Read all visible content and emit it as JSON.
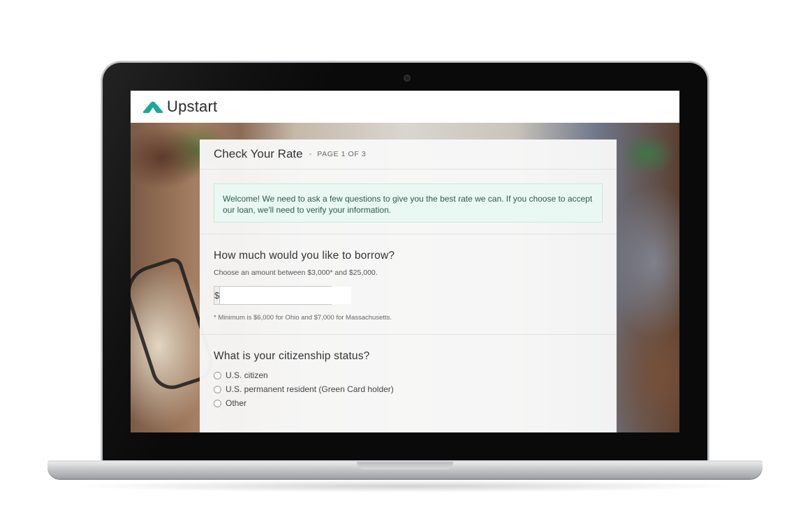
{
  "app": {
    "brand": "Upstart",
    "brand_color": "#1aa99a"
  },
  "form": {
    "title": "Check Your Rate",
    "separator": "-",
    "page_indicator": "PAGE 1 OF 3",
    "notice": "Welcome! We need to ask a few questions to give you the best rate we can. If you choose to accept our loan, we'll need to verify your information.",
    "borrow": {
      "question": "How much would you like to borrow?",
      "help": "Choose an amount between $3,000* and $25,000.",
      "currency_symbol": "$",
      "value": "",
      "footnote": "* Minimum is $6,000 for Ohio and $7,000 for Massachusetts."
    },
    "citizenship": {
      "question": "What is your citizenship status?",
      "options": [
        "U.S. citizen",
        "U.S. permanent resident (Green Card holder)",
        "Other"
      ]
    }
  },
  "device": {
    "icons": [
      "camera-icon",
      "upstart-logo-icon"
    ]
  }
}
